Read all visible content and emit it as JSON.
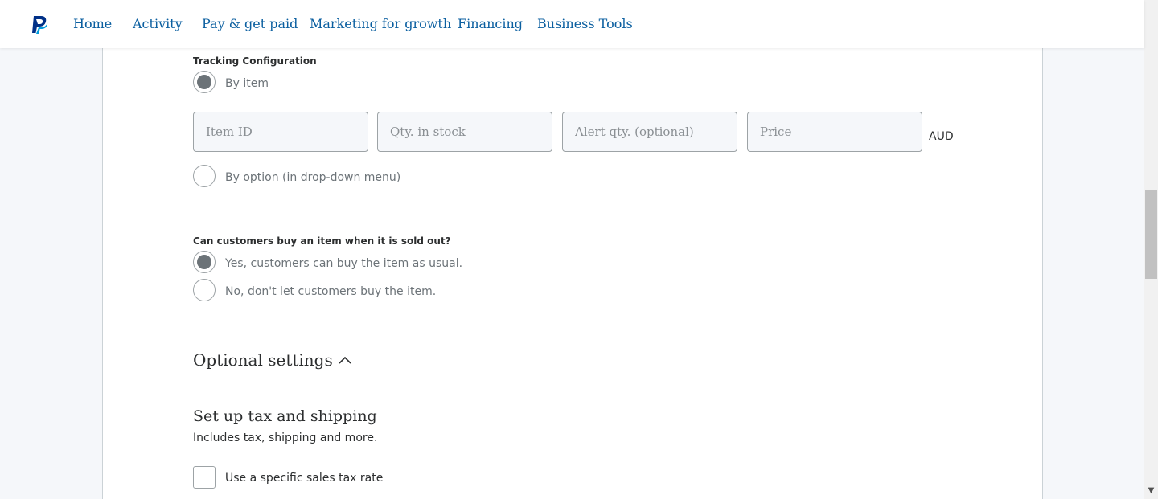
{
  "nav": {
    "logo_icon": "paypal-logo-icon",
    "items": [
      {
        "label": "Home"
      },
      {
        "label": "Activity"
      },
      {
        "label": "Pay & get paid"
      },
      {
        "label": "Marketing for growth"
      },
      {
        "label": "Financing"
      },
      {
        "label": "Business Tools"
      }
    ]
  },
  "tracking": {
    "heading": "Tracking Configuration",
    "by_item_label": "By item",
    "by_option_label": "By option (in drop-down menu)",
    "fields": {
      "item_id": {
        "placeholder": "Item ID",
        "value": ""
      },
      "qty": {
        "placeholder": "Qty. in stock",
        "value": ""
      },
      "alert": {
        "placeholder": "Alert qty. (optional)",
        "value": ""
      },
      "price": {
        "placeholder": "Price",
        "value": ""
      }
    },
    "currency": "AUD"
  },
  "sold_out": {
    "heading": "Can customers buy an item when it is sold out?",
    "yes_label": "Yes, customers can buy the item as usual.",
    "no_label": "No, don't let customers buy the item."
  },
  "optional": {
    "title": "Optional settings",
    "chevron_icon": "chevron-up-icon"
  },
  "tax": {
    "title": "Set up tax and shipping",
    "subtitle": "Includes tax, shipping and more.",
    "checkbox_label": "Use a specific sales tax rate"
  },
  "colors": {
    "nav_link": "#0b5fa0",
    "radio_checked": "#6c7378",
    "page_bg": "#f5f7fa"
  }
}
